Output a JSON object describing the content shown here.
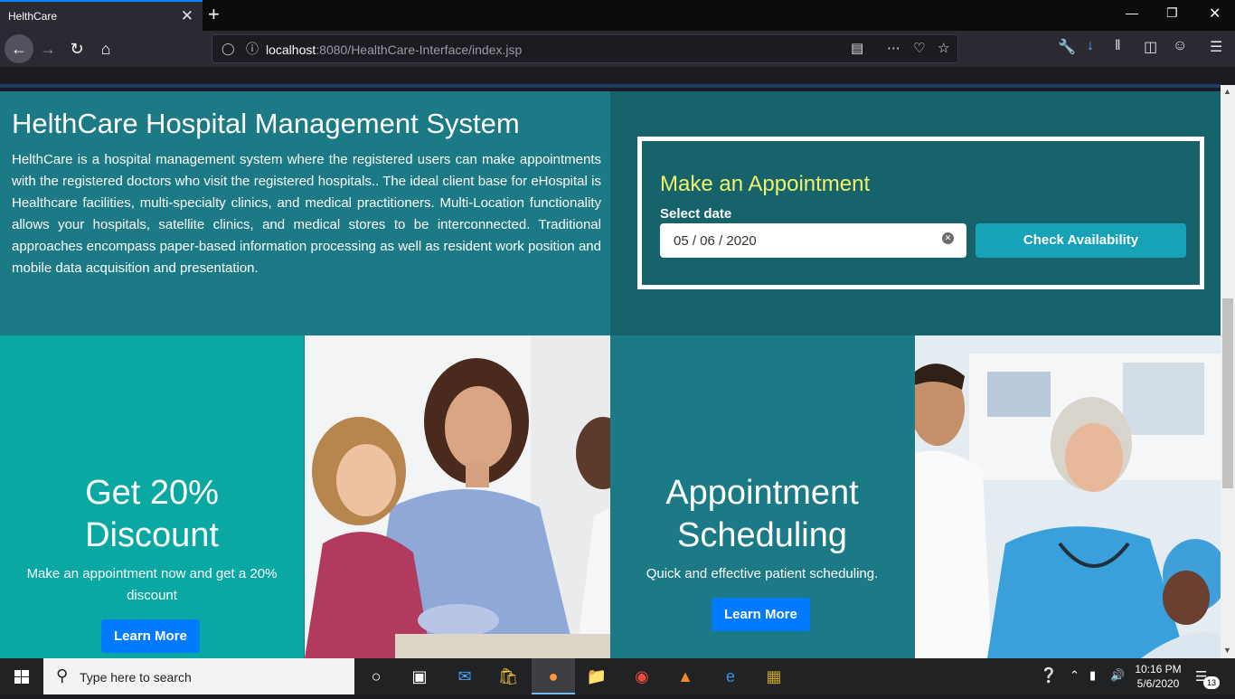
{
  "browser": {
    "tab_title": "HelthCare",
    "tab_close": "✕",
    "new_tab": "+",
    "url_host": "localhost",
    "url_rest": ":8080/HealthCare-Interface/index.jsp"
  },
  "intro": {
    "title": "HelthCare Hospital Management System",
    "body": "HelthCare is a hospital management system where the registered users can make appointments with the registered doctors who visit the registered hospitals.. The ideal client base for eHospital is Healthcare facilities, multi-specialty clinics, and medical practitioners. Multi-Location functionality allows your hospitals, satellite clinics, and medical stores to be interconnected. Traditional approaches encompass paper-based information processing as well as resident work position and mobile data acquisition and presentation."
  },
  "appointment": {
    "heading": "Make an Appointment",
    "date_label": "Select date",
    "date_value": "05 / 06 / 2020",
    "check_button": "Check Availability"
  },
  "promos": [
    {
      "title_line1": "Get 20%",
      "title_line2": "Discount",
      "subtitle": "Make an appointment now and get a 20% discount",
      "button": "Learn More"
    },
    {
      "title_line1": "Appointment",
      "title_line2": "Scheduling",
      "subtitle": "Quick and effective patient scheduling.",
      "button": "Learn More"
    }
  ],
  "taskbar": {
    "search_placeholder": "Type here to search",
    "time": "10:16 PM",
    "date": "5/6/2020",
    "notification_count": "13"
  },
  "colors": {
    "accent_blue": "#007bff",
    "teal_dark": "#17636b",
    "teal_mid": "#1b7a86",
    "teal_bright": "#0aa8a2",
    "check_button": "#17a2b8",
    "heading_yellow": "#ecf26b"
  }
}
